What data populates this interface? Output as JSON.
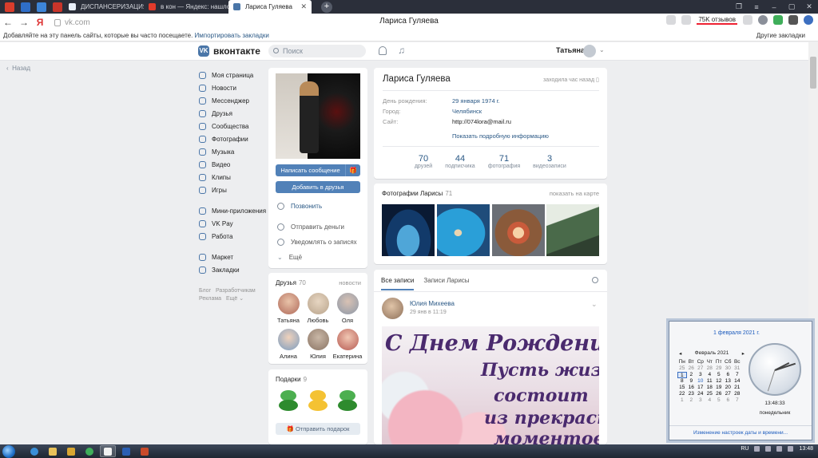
{
  "browser": {
    "tabs": [
      {
        "label": "ДИСПАНСЕРИЗАЦИЯ 202",
        "active": false
      },
      {
        "label": "в кон — Яндекс: нашлось",
        "active": false
      },
      {
        "label": "Лариса Гуляева",
        "active": true
      }
    ],
    "new_tab": "+",
    "url": "vk.com",
    "page_title": "Лариса Гуляева",
    "reviews": "75K отзывов",
    "bookmarks_text": "Добавляйте на эту панель сайты, которые вы часто посещаете.",
    "bookmarks_link": "Импортировать закладки",
    "other_bookmarks": "Другие закладки"
  },
  "vk": {
    "logo": "вконтакте",
    "search_placeholder": "Поиск",
    "user_name": "Татьяна",
    "back": "Назад",
    "nav": [
      "Моя страница",
      "Новости",
      "Мессенджер",
      "Друзья",
      "Сообщества",
      "Фотографии",
      "Музыка",
      "Видео",
      "Клипы",
      "Игры"
    ],
    "nav2": [
      "Мини-приложения",
      "VK Pay",
      "Работа"
    ],
    "nav3": [
      "Маркет",
      "Закладки"
    ],
    "footer": [
      "Блог",
      "Разработчикам",
      "Реклама",
      "Ещё"
    ]
  },
  "profile": {
    "write_message": "Написать сообщение",
    "add_friend": "Добавить в друзья",
    "call": "Позвонить",
    "send_money": "Отправить деньги",
    "notify": "Уведомлять о записях",
    "more": "Ещё",
    "name": "Лариса Гуляева",
    "status": "заходила час назад",
    "info": [
      {
        "label": "День рождения:",
        "value": "29 января 1974 г."
      },
      {
        "label": "Город:",
        "value": "Челябинск"
      },
      {
        "label": "Сайт:",
        "value": "http://074lora@mail.ru"
      }
    ],
    "show_more": "Показать подробную информацию",
    "stats": [
      {
        "n": "70",
        "l": "друзей"
      },
      {
        "n": "44",
        "l": "подписчика"
      },
      {
        "n": "71",
        "l": "фотография"
      },
      {
        "n": "3",
        "l": "видеозаписи"
      }
    ]
  },
  "friends": {
    "title": "Друзья",
    "count": "70",
    "link": "новости",
    "items": [
      {
        "name": "Татьяна",
        "color": "#b06a5a"
      },
      {
        "name": "Любовь",
        "color": "#b9a48c"
      },
      {
        "name": "Оля",
        "color": "#8c98a8"
      },
      {
        "name": "Алина",
        "color": "#7b9cc0"
      },
      {
        "name": "Юлия",
        "color": "#8a7464"
      },
      {
        "name": "Екатерина",
        "color": "#b65a52"
      }
    ]
  },
  "gifts": {
    "title": "Подарки",
    "count": "9",
    "button": "Отправить подарок"
  },
  "photos": {
    "title": "Фотографии Ларисы",
    "count": "71",
    "map_link": "показать на карте",
    "thumbs": [
      "#1b2a4a",
      "#1f4c7a",
      "#8a5a3a",
      "#3d5a3a"
    ]
  },
  "wall": {
    "tab_all": "Все записи",
    "tab_own": "Записи Ларисы",
    "post_author": "Юлия Михеева",
    "post_date": "29 янв в 11:19",
    "post_lines": [
      "С Днем Рождения!",
      "Пусть жизнь",
      "состоит",
      "из прекрасных",
      "моментов:"
    ]
  },
  "calendar": {
    "date_link": "1 февраля 2021 г.",
    "month": "Февраль 2021",
    "weekdays": [
      "Пн",
      "Вт",
      "Ср",
      "Чт",
      "Пт",
      "Сб",
      "Вс"
    ],
    "days": [
      [
        "25",
        "26",
        "27",
        "28",
        "29",
        "30",
        "31"
      ],
      [
        "1",
        "2",
        "3",
        "4",
        "5",
        "6",
        "7"
      ],
      [
        "8",
        "9",
        "10",
        "11",
        "12",
        "13",
        "14"
      ],
      [
        "15",
        "16",
        "17",
        "18",
        "19",
        "20",
        "21"
      ],
      [
        "22",
        "23",
        "24",
        "25",
        "26",
        "27",
        "28"
      ],
      [
        "1",
        "2",
        "3",
        "4",
        "5",
        "6",
        "7"
      ]
    ],
    "time": "13:48:33",
    "weekday": "понедельник",
    "settings_link": "Изменение настроек даты и времени..."
  },
  "taskbar": {
    "lang": "RU",
    "time": "13:48"
  },
  "colors": {
    "vk_blue": "#4a76a8",
    "vk_button": "#5181b8",
    "link": "#2a5885",
    "background": "#edeef0"
  }
}
